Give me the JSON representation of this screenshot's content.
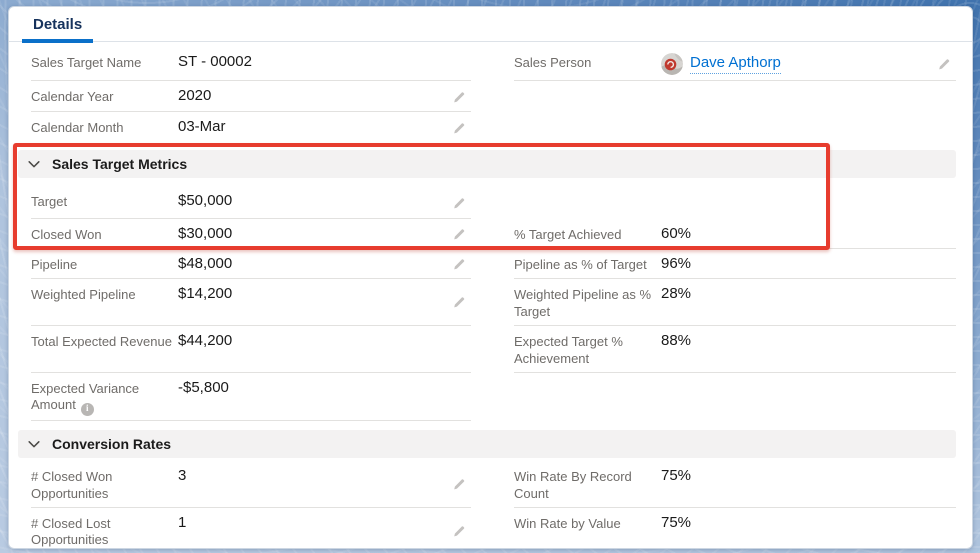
{
  "header": {
    "tab_details": "Details"
  },
  "top": {
    "sales_target_name": {
      "label": "Sales Target Name",
      "value": "ST - 00002"
    },
    "sales_person": {
      "label": "Sales Person",
      "value": "Dave Apthorp"
    },
    "calendar_year": {
      "label": "Calendar Year",
      "value": "2020"
    },
    "calendar_month": {
      "label": "Calendar Month",
      "value": "03-Mar"
    }
  },
  "metrics": {
    "title": "Sales Target Metrics",
    "target": {
      "label": "Target",
      "value": "$50,000"
    },
    "closed_won": {
      "label": "Closed Won",
      "value": "$30,000"
    },
    "pct_target_achieved": {
      "label": "% Target Achieved",
      "value": "60%"
    },
    "pipeline": {
      "label": "Pipeline",
      "value": "$48,000"
    },
    "pipeline_pct_of_target": {
      "label": "Pipeline as % of Target",
      "value": "96%"
    },
    "weighted_pipeline": {
      "label": "Weighted Pipeline",
      "value": "$14,200"
    },
    "weighted_pipeline_pct_target": {
      "label": "Weighted Pipeline as % Target",
      "value": "28%"
    },
    "total_expected_revenue": {
      "label": "Total Expected Revenue",
      "value": "$44,200"
    },
    "expected_target_pct_achievement": {
      "label": "Expected Target % Achievement",
      "value": "88%"
    },
    "expected_variance_amount": {
      "label": "Expected Variance Amount",
      "value": "-$5,800"
    }
  },
  "conversion": {
    "title": "Conversion Rates",
    "closed_won_opportunities": {
      "label": "# Closed Won Opportunities",
      "value": "3"
    },
    "win_rate_by_record_count": {
      "label": "Win Rate By Record Count",
      "value": "75%"
    },
    "closed_lost_opportunities": {
      "label": "# Closed Lost Opportunities",
      "value": "1"
    },
    "win_rate_by_value": {
      "label": "Win Rate by Value",
      "value": "75%"
    }
  },
  "icons": {
    "info_glyph": "i"
  },
  "colors": {
    "accent_blue": "#0b70c9",
    "link_blue": "#0070d2",
    "highlight_red": "#e73c2e",
    "section_bg": "#f3f2f2"
  }
}
